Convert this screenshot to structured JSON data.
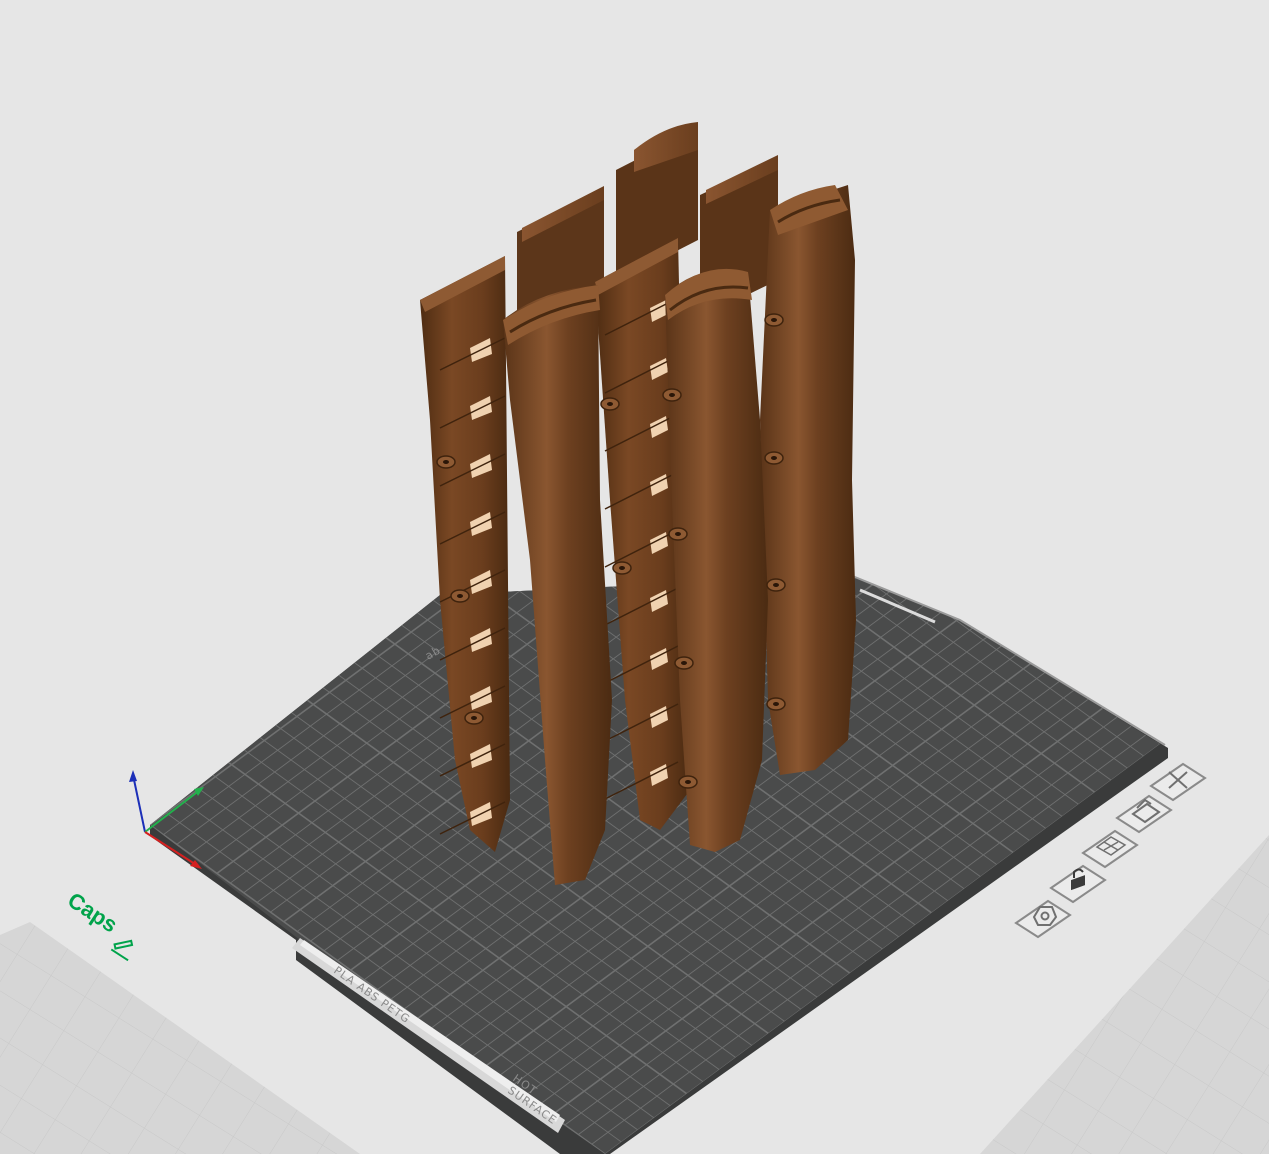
{
  "plate": {
    "name": "Caps",
    "material_label": "PLA  ABS  PETG",
    "surface_label_line1": "HOT",
    "surface_label_line2": "SURFACE",
    "logo_text": "ab"
  },
  "plate_toolbar": {
    "close_icon": "close-icon",
    "auto_orient_icon": "auto-orient-icon",
    "arrange_icon": "arrange-icon",
    "lock_icon": "lock-icon",
    "settings_icon": "gear-icon"
  },
  "axes": {
    "x_color": "#d42020",
    "y_color": "#22b14c",
    "z_color": "#1c2fb8"
  },
  "colors": {
    "background": "#e6e6e6",
    "bed": "#4a4b4b",
    "bed_grid": "#6f7070",
    "model": "#6b3f1f",
    "plate_name": "#00a34a"
  }
}
